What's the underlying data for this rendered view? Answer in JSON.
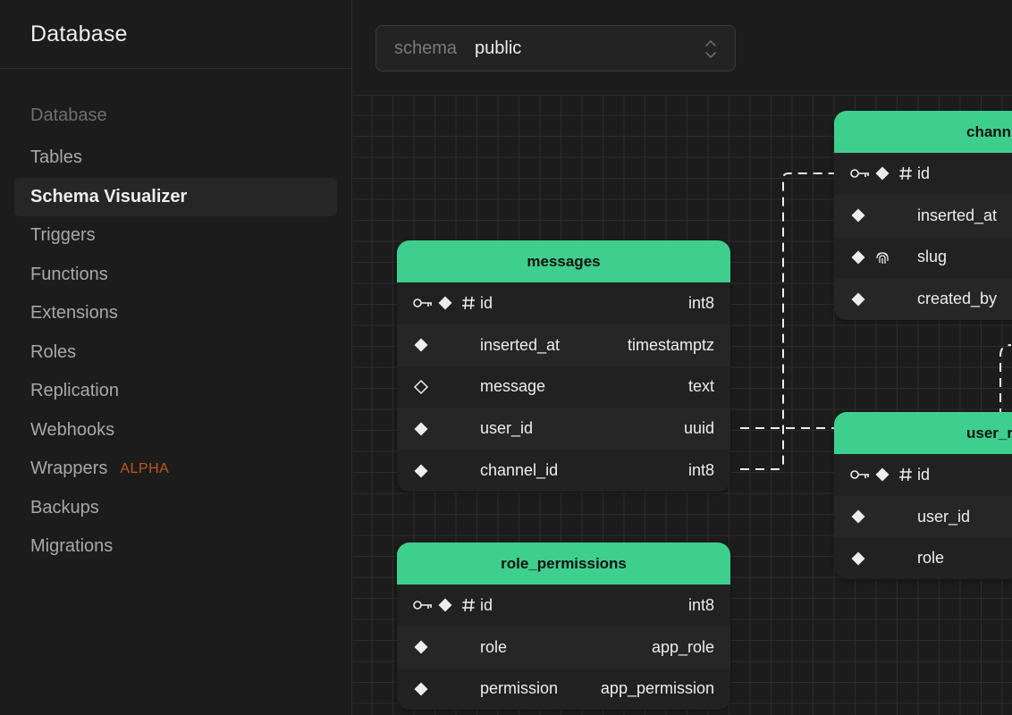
{
  "sidebar": {
    "title": "Database",
    "section": "Database",
    "items": [
      {
        "label": "Tables"
      },
      {
        "label": "Schema Visualizer",
        "active": true
      },
      {
        "label": "Triggers"
      },
      {
        "label": "Functions"
      },
      {
        "label": "Extensions"
      },
      {
        "label": "Roles"
      },
      {
        "label": "Replication"
      },
      {
        "label": "Webhooks"
      },
      {
        "label": "Wrappers",
        "badge": "ALPHA"
      },
      {
        "label": "Backups"
      },
      {
        "label": "Migrations"
      }
    ]
  },
  "toolbar": {
    "schema_label": "schema",
    "schema_value": "public"
  },
  "colors": {
    "accent": "#3ecf8e",
    "badge": "#c2571a",
    "background": "#1c1c1c"
  },
  "tables": {
    "messages": {
      "name": "messages",
      "columns": [
        {
          "name": "id",
          "type": "int8",
          "icons": [
            "key-icon",
            "diamond-filled-icon",
            "hash-icon"
          ]
        },
        {
          "name": "inserted_at",
          "type": "timestamptz",
          "icons": [
            "diamond-filled-icon"
          ]
        },
        {
          "name": "message",
          "type": "text",
          "icons": [
            "diamond-outline-icon"
          ]
        },
        {
          "name": "user_id",
          "type": "uuid",
          "icons": [
            "diamond-filled-icon"
          ]
        },
        {
          "name": "channel_id",
          "type": "int8",
          "icons": [
            "diamond-filled-icon"
          ]
        }
      ]
    },
    "role_permissions": {
      "name": "role_permissions",
      "columns": [
        {
          "name": "id",
          "type": "int8",
          "icons": [
            "key-icon",
            "diamond-filled-icon",
            "hash-icon"
          ]
        },
        {
          "name": "role",
          "type": "app_role",
          "icons": [
            "diamond-filled-icon"
          ]
        },
        {
          "name": "permission",
          "type": "app_permission",
          "icons": [
            "diamond-filled-icon"
          ]
        }
      ]
    },
    "channels": {
      "name": "chann",
      "columns": [
        {
          "name": "id",
          "icons": [
            "key-icon",
            "diamond-filled-icon",
            "hash-icon"
          ]
        },
        {
          "name": "inserted_at",
          "icons": [
            "diamond-filled-icon"
          ]
        },
        {
          "name": "slug",
          "icons": [
            "diamond-filled-icon",
            "fingerprint-icon"
          ]
        },
        {
          "name": "created_by",
          "icons": [
            "diamond-filled-icon"
          ]
        }
      ]
    },
    "user_roles": {
      "name": "user_ro",
      "columns": [
        {
          "name": "id",
          "icons": [
            "key-icon",
            "diamond-filled-icon",
            "hash-icon"
          ]
        },
        {
          "name": "user_id",
          "icons": [
            "diamond-filled-icon"
          ]
        },
        {
          "name": "role",
          "icons": [
            "diamond-filled-icon"
          ]
        }
      ]
    }
  }
}
